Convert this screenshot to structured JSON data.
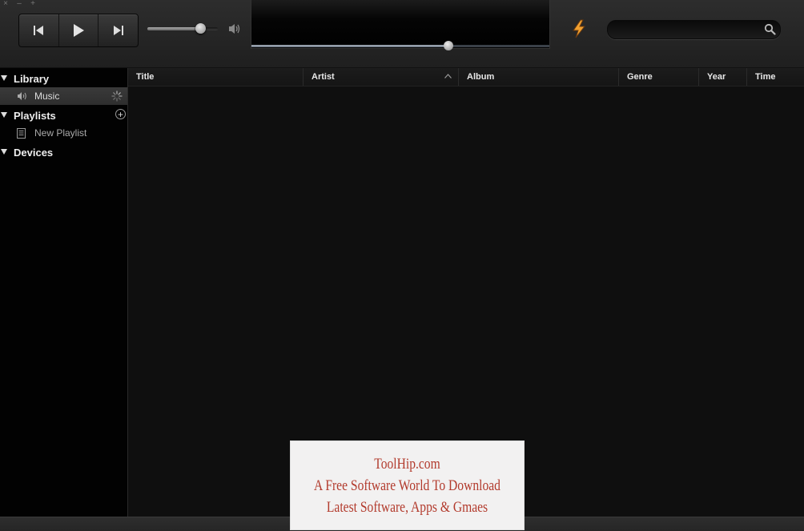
{
  "window": {
    "controls": [
      "×",
      "–",
      "+"
    ]
  },
  "player": {
    "volume_percent": 75,
    "seek_percent": 66
  },
  "search": {
    "value": "",
    "placeholder": ""
  },
  "sidebar": {
    "library": {
      "label": "Library",
      "items": [
        {
          "label": "Music"
        }
      ]
    },
    "playlists": {
      "label": "Playlists",
      "items": [
        {
          "label": "New Playlist"
        }
      ]
    },
    "devices": {
      "label": "Devices"
    }
  },
  "table": {
    "columns": [
      "Title",
      "Artist",
      "Album",
      "Genre",
      "Year",
      "Time"
    ],
    "sorted_column": "Artist",
    "rows": []
  },
  "watermark": {
    "line1": "ToolHip.com",
    "line2": "A Free Software World To Download",
    "line3": "Latest Software, Apps & Gmaes"
  },
  "colors": {
    "accent": "#f0a030",
    "seek": "#8a96a3"
  }
}
